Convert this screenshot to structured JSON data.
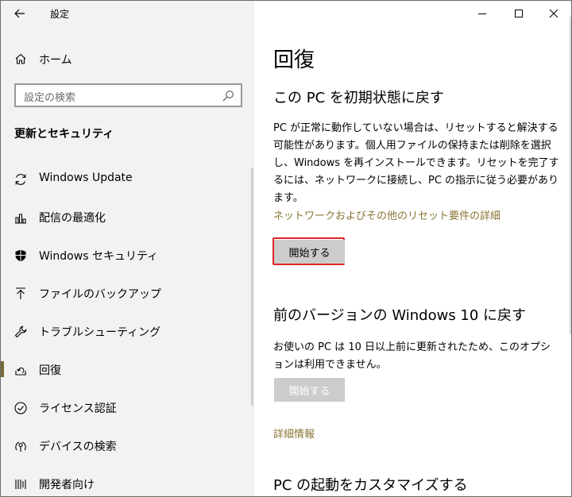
{
  "window": {
    "app_title": "設定"
  },
  "sidebar": {
    "home_label": "ホーム",
    "search_placeholder": "設定の検索",
    "section_title": "更新とセキュリティ",
    "items": [
      {
        "label": "Windows Update",
        "icon": "sync-icon"
      },
      {
        "label": "配信の最適化",
        "icon": "delivery-optimization-icon"
      },
      {
        "label": "Windows セキュリティ",
        "icon": "shield-icon"
      },
      {
        "label": "ファイルのバックアップ",
        "icon": "backup-arrow-icon"
      },
      {
        "label": "トラブルシューティング",
        "icon": "wrench-icon"
      },
      {
        "label": "回復",
        "icon": "recovery-icon",
        "selected": true
      },
      {
        "label": "ライセンス認証",
        "icon": "checkmark-circle-icon"
      },
      {
        "label": "デバイスの検索",
        "icon": "find-device-icon"
      },
      {
        "label": "開発者向け",
        "icon": "developer-icon"
      }
    ]
  },
  "main": {
    "page_title": "回復",
    "reset": {
      "heading": "この PC を初期状態に戻す",
      "description": "PC が正常に動作していない場合は、リセットすると解決する可能性があります。個人用ファイルの保持または削除を選択し、Windows を再インストールできます。リセットを完了するには、ネットワークに接続し、PC の指示に従う必要があります。",
      "link": "ネットワークおよびその他のリセット要件の詳細",
      "button": "開始する"
    },
    "rollback": {
      "heading": "前のバージョンの Windows 10 に戻す",
      "description": "お使いの PC は 10 日以上前に更新されたため、このオプションは利用できません。",
      "button": "開始する",
      "link": "詳細情報"
    },
    "advanced": {
      "heading": "PC の起動をカスタマイズする"
    }
  },
  "colors": {
    "sidebar_bg": "#f2f2f2",
    "link": "#8a7435",
    "highlight_border": "#e0252a",
    "selected_bar": "#7a6a3a"
  }
}
